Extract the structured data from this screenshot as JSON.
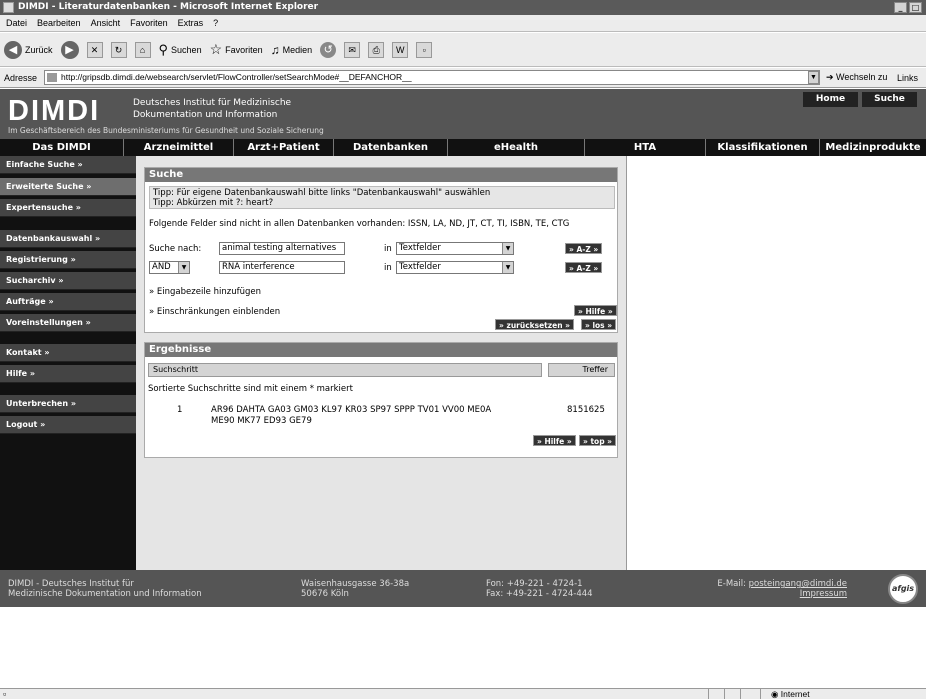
{
  "window": {
    "title": "DIMDI - Literaturdatenbanken - Microsoft Internet Explorer",
    "controls": [
      "_",
      "□"
    ]
  },
  "menubar": [
    "Datei",
    "Bearbeiten",
    "Ansicht",
    "Favoriten",
    "Extras",
    "?"
  ],
  "toolbar": {
    "back": "Zurück",
    "search": "Suchen",
    "favorites": "Favoriten",
    "media": "Medien"
  },
  "addressbar": {
    "label": "Adresse",
    "url": "http://gripsdb.dimdi.de/websearch/servlet/FlowController/setSearchMode#__DEFANCHOR__",
    "go": "Wechseln zu",
    "links": "Links"
  },
  "header": {
    "logo": "DIMDI",
    "institute_line1": "Deutsches Institut für Medizinische",
    "institute_line2": "Dokumentation und Information",
    "subtitle": "Im Geschäftsbereich des Bundesministeriums für Gesundheit und Soziale Sicherung",
    "home": "Home",
    "search": "Suche"
  },
  "nav": [
    "Das DIMDI",
    "Arzneimittel",
    "Arzt+Patient",
    "Datenbanken",
    "eHealth",
    "HTA",
    "Klassifikationen",
    "Medizinprodukte"
  ],
  "sidebar": [
    "Einfache Suche »",
    "Erweiterte Suche »",
    "Expertensuche »",
    "Datenbankauswahl »",
    "Registrierung »",
    "Sucharchiv »",
    "Aufträge »",
    "Voreinstellungen »",
    "Kontakt »",
    "Hilfe »",
    "Unterbrechen »",
    "Logout »"
  ],
  "search": {
    "title": "Suche",
    "tip1": "Tipp: Für eigene Datenbankauswahl bitte links \"Datenbankauswahl\" auswählen",
    "tip2": "Tipp: Abkürzen mit ?: heart?",
    "fields_note": "Folgende Felder sind nicht in allen Datenbanken vorhanden: ISSN, LA, ND, JT, CT, TI, ISBN, TE, CTG",
    "search_label": "Suche nach:",
    "query1": "animal testing alternatives",
    "in1": "in",
    "field1": "Textfelder",
    "az1": "» A-Z »",
    "operator": "AND",
    "query2": "RNA interference",
    "in2": "in",
    "field2": "Textfelder",
    "az2": "» A-Z »",
    "add_line": "» Eingabezeile hinzufügen",
    "restrictions": "» Einschränkungen einblenden",
    "help": "» Hilfe »",
    "reset": "» zurücksetzen »",
    "go": "» los »"
  },
  "results": {
    "title": "Ergebnisse",
    "col_step": "Suchschritt",
    "col_hits": "Treffer",
    "note": "Sortierte Suchschritte sind mit einem * markiert",
    "rows": [
      {
        "num": "1",
        "line1": "AR96 DAHTA GA03 GM03 KL97 KR03 SP97 SPPP TV01 VV00 ME0A",
        "line2": "ME90 MK77 ED93 GE79",
        "hits": "8151625"
      }
    ],
    "help": "» Hilfe »",
    "top": "» top »"
  },
  "footer": {
    "name1": "DIMDI - Deutsches Institut für",
    "name2": "Medizinische Dokumentation und Information",
    "addr1": "Waisenhausgasse 36-38a",
    "addr2": "50676 Köln",
    "phone": "Fon: +49-221 - 4724-1",
    "fax": "Fax: +49-221 - 4724-444",
    "email_label": "E-Mail:",
    "email": "posteingang@dimdi.de",
    "impressum": "Impressum",
    "badge": "afgis"
  },
  "statusbar": {
    "zone": "Internet"
  }
}
